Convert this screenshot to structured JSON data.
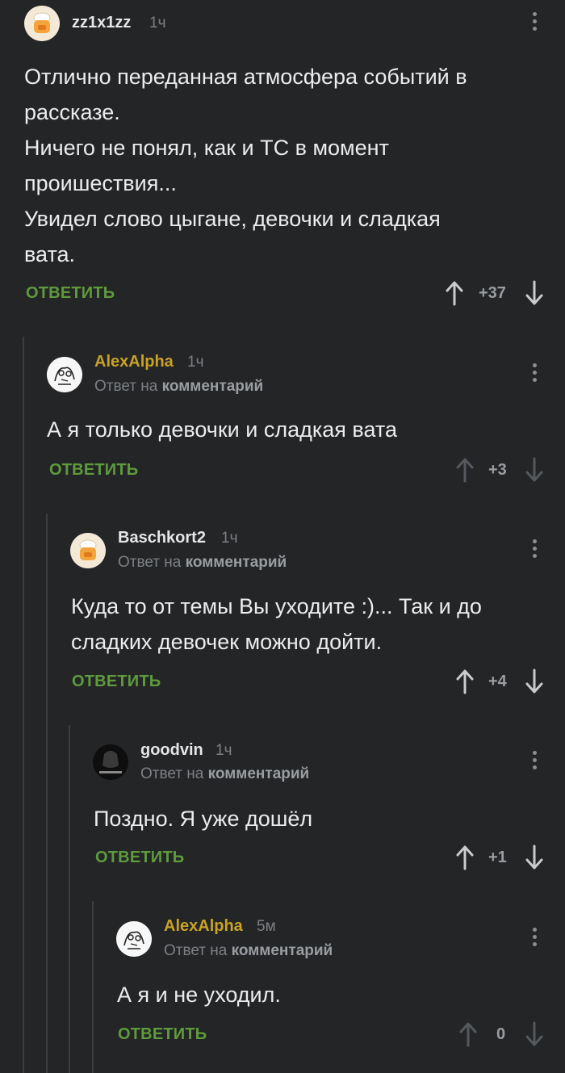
{
  "comments": [
    {
      "username": "zz1x1zz",
      "time": "1ч",
      "text_lines": [
        "Отлично переданная атмосфера событий в",
        "рассказе.",
        "Ничего не понял, как и ТС в момент",
        "проишествия...",
        "Увидел слово цыгане, девочки и сладкая",
        "вата."
      ],
      "reply_label": "ОТВЕТИТЬ",
      "score": "+37"
    },
    {
      "username": "AlexAlpha",
      "time": "1ч",
      "reply_prefix": "Ответ на",
      "reply_target": "комментарий",
      "text_lines": [
        "А я только девочки и сладкая вата"
      ],
      "reply_label": "ОТВЕТИТЬ",
      "score": "+3"
    },
    {
      "username": "Baschkort2",
      "time": "1ч",
      "reply_prefix": "Ответ на",
      "reply_target": "комментарий",
      "text_lines": [
        "Куда то от темы Вы уходите :)... Так и до",
        "сладких девочек можно дойти."
      ],
      "reply_label": "ОТВЕТИТЬ",
      "score": "+4"
    },
    {
      "username": "goodvin",
      "time": "1ч",
      "reply_prefix": "Ответ на",
      "reply_target": "комментарий",
      "text_lines": [
        "Поздно. Я уже дошёл"
      ],
      "reply_label": "ОТВЕТИТЬ",
      "score": "+1"
    },
    {
      "username": "AlexAlpha",
      "time": "5м",
      "reply_prefix": "Ответ на",
      "reply_target": "комментарий",
      "text_lines": [
        "А я и не уходил."
      ],
      "reply_label": "ОТВЕТИТЬ",
      "score": "0"
    }
  ],
  "colors": {
    "background": "#232527",
    "reply_green": "#5f9b3c",
    "username_gold": "#c9a227",
    "muted": "#7d8084"
  }
}
